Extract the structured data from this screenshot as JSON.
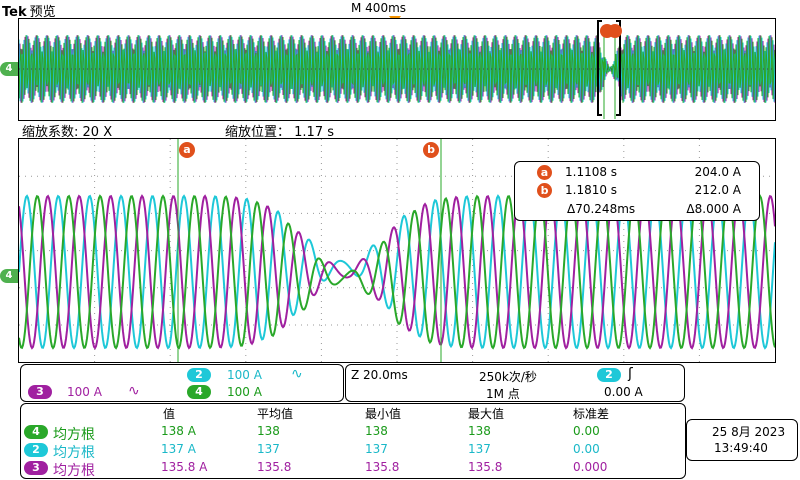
{
  "header": {
    "brand": "Tek",
    "mode": "预览",
    "timebase": "M 400ms"
  },
  "zoom": {
    "factor_label": "缩放系数:",
    "factor_value": "20 X",
    "position_label": "缩放位置：",
    "position_value": "1.17 s"
  },
  "cursors": {
    "a_label": "a",
    "b_label": "b",
    "a_time": "1.1108 s",
    "a_value": "204.0 A",
    "b_time": "1.1810 s",
    "b_value": "212.0 A",
    "delta_time": "Δ70.248ms",
    "delta_value": "Δ8.000 A"
  },
  "channel_marker": "4",
  "channels": {
    "ch2_num": "2",
    "ch2_scale": "100 A",
    "ch3_num": "3",
    "ch3_scale": "100 A",
    "ch4_num": "4",
    "ch4_scale": "100 A",
    "coupling_symbol": "∿"
  },
  "acquisition": {
    "zoom_timebase": "Z 20.0ms",
    "sample_rate": "250k次/秒",
    "record_length": "1M 点",
    "trigger_channel": "2",
    "trigger_slope": "ʃ",
    "trigger_level": "0.00 A"
  },
  "stats": {
    "headers": [
      "值",
      "平均值",
      "最小值",
      "最大值",
      "标准差"
    ],
    "rows": [
      {
        "ch": "4",
        "name": "均方根",
        "value": "138 A",
        "mean": "138",
        "min": "138",
        "max": "138",
        "std": "0.00"
      },
      {
        "ch": "2",
        "name": "均方根",
        "value": "137 A",
        "mean": "137",
        "min": "137",
        "max": "137",
        "std": "0.00"
      },
      {
        "ch": "3",
        "name": "均方根",
        "value": "135.8 A",
        "mean": "135.8",
        "min": "135.8",
        "max": "135.8",
        "std": "0.000"
      }
    ]
  },
  "datetime": {
    "date": "25 8月 2023",
    "time": "13:49:40"
  },
  "colors": {
    "ch2": "#1ec8d8",
    "ch3": "#a020a0",
    "ch4": "#2aa82a",
    "cursor": "#e0501c",
    "trigger": "#f39200"
  }
}
